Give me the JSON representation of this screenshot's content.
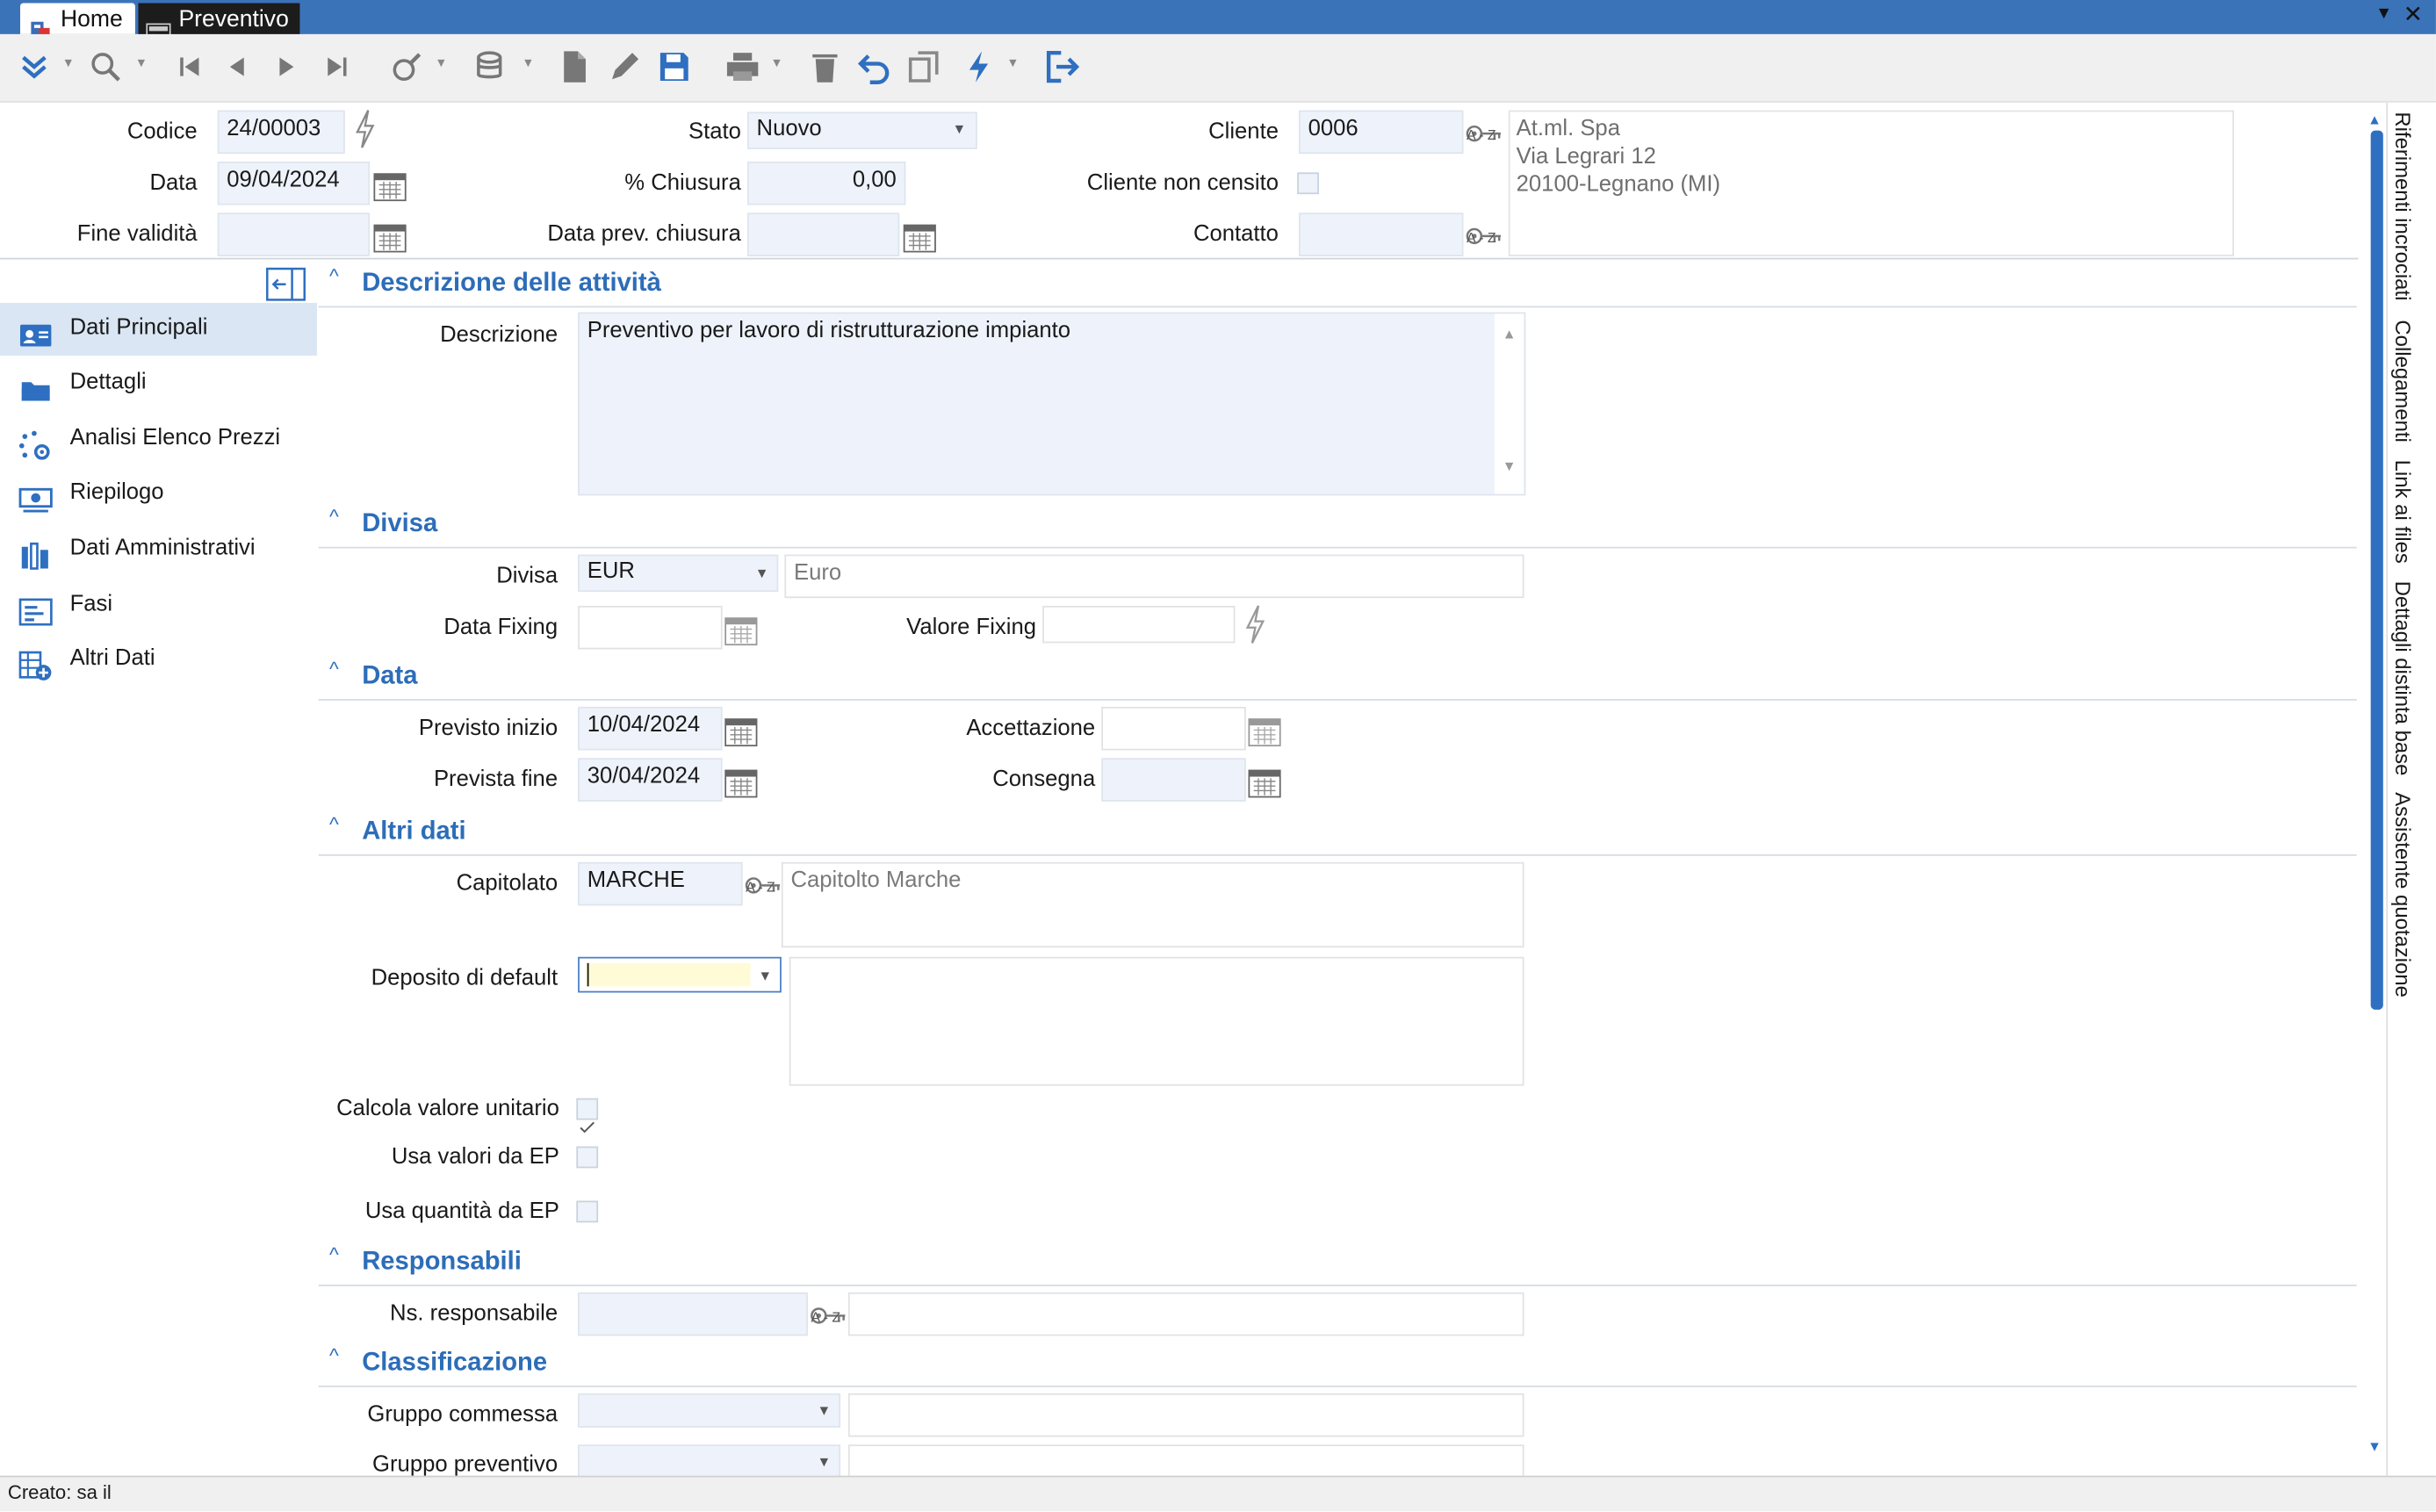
{
  "tabs": [
    {
      "label": "Home"
    },
    {
      "label": "Preventivo"
    }
  ],
  "colors": {
    "titlebar": "#3b73b9",
    "accent": "#2d6db8",
    "field_bg": "#eef3fb",
    "nav_selected": "#dbe6f4"
  },
  "header": {
    "codice_label": "Codice",
    "codice_value": "24/00003",
    "data_label": "Data",
    "data_value": "09/04/2024",
    "fine_validita_label": "Fine validità",
    "fine_validita_value": "",
    "stato_label": "Stato",
    "stato_value": "Nuovo",
    "chiusura_label": "% Chiusura",
    "chiusura_value": "0,00",
    "data_prev_chiusura_label": "Data prev. chiusura",
    "data_prev_chiusura_value": "",
    "cliente_label": "Cliente",
    "cliente_value": "0006",
    "cliente_non_censito_label": "Cliente non censito",
    "contatto_label": "Contatto",
    "contatto_value": "",
    "address": {
      "line1": "At.ml. Spa",
      "line2": "Via Legrari 12",
      "line3": "20100-Legnano (MI)"
    }
  },
  "sidebar": {
    "items": [
      {
        "label": "Dati Principali",
        "icon": "id-card-icon",
        "selected": true
      },
      {
        "label": "Dettagli",
        "icon": "folder-icon"
      },
      {
        "label": "Analisi Elenco Prezzi",
        "icon": "gear-dots-icon"
      },
      {
        "label": "Riepilogo",
        "icon": "money-icon"
      },
      {
        "label": "Dati Amministrativi",
        "icon": "ledger-icon"
      },
      {
        "label": "Fasi",
        "icon": "phases-icon"
      },
      {
        "label": "Altri Dati",
        "icon": "table-add-icon"
      }
    ]
  },
  "sections": {
    "descrizione": {
      "title": "Descrizione delle attività",
      "field_label": "Descrizione",
      "value": "Preventivo per lavoro di ristrutturazione impianto"
    },
    "divisa": {
      "title": "Divisa",
      "divisa_label": "Divisa",
      "divisa_value": "EUR",
      "divisa_desc": "Euro",
      "data_fixing_label": "Data Fixing",
      "data_fixing_value": "",
      "valore_fixing_label": "Valore Fixing",
      "valore_fixing_value": ""
    },
    "data": {
      "title": "Data",
      "previsto_inizio_label": "Previsto inizio",
      "previsto_inizio_value": "10/04/2024",
      "prevista_fine_label": "Prevista fine",
      "prevista_fine_value": "30/04/2024",
      "accettazione_label": "Accettazione",
      "accettazione_value": "",
      "consegna_label": "Consegna",
      "consegna_value": ""
    },
    "altri": {
      "title": "Altri dati",
      "capitolato_label": "Capitolato",
      "capitolato_value": "MARCHE",
      "capitolato_desc": "Capitolto Marche",
      "deposito_label": "Deposito di default",
      "deposito_value": "",
      "calcola_label": "Calcola valore unitario",
      "calcola_checked": true,
      "usa_valori_label": "Usa valori da EP",
      "usa_valori_checked": false,
      "usa_quantita_label": "Usa quantità da EP",
      "usa_quantita_checked": false
    },
    "responsabili": {
      "title": "Responsabili",
      "ns_resp_label": "Ns. responsabile",
      "ns_resp_value": ""
    },
    "classificazione": {
      "title": "Classificazione",
      "gruppo_commessa_label": "Gruppo commessa",
      "gruppo_preventivo_label": "Gruppo preventivo"
    }
  },
  "right_tabs": [
    "Riferimenti incrociati",
    "Collegamenti",
    "Link ai files",
    "Dettagli distinta base",
    "Assistente quotazione"
  ],
  "key_caption": "A - Z",
  "status_bar": "Creato: sa il"
}
